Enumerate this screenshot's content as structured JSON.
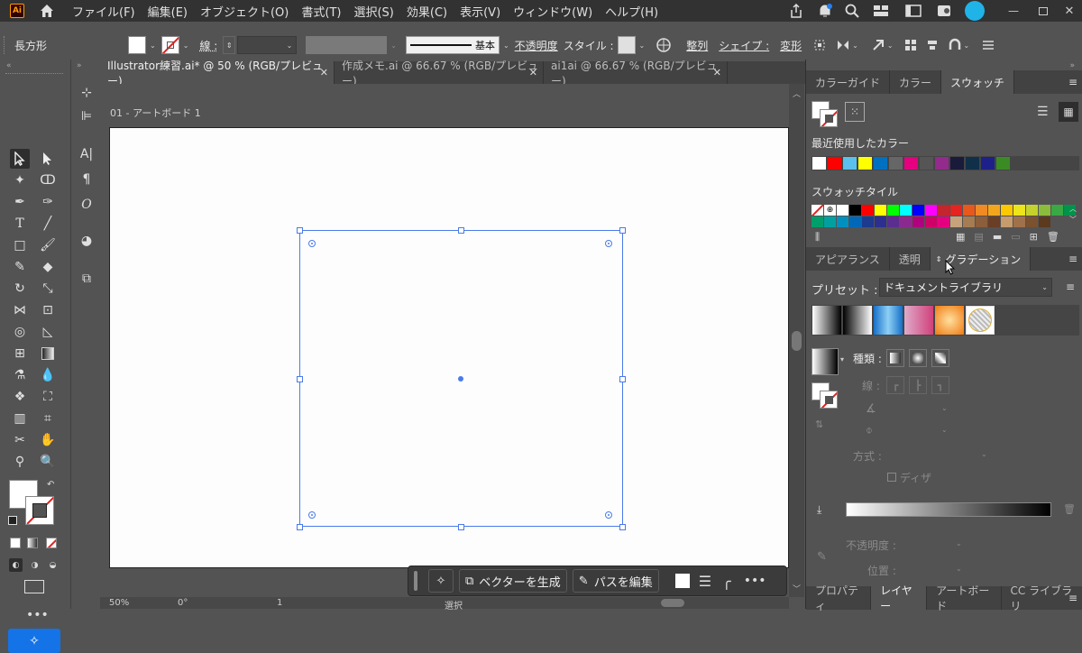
{
  "app": {
    "logo": "Ai"
  },
  "menu": [
    "ファイル(F)",
    "編集(E)",
    "オブジェクト(O)",
    "書式(T)",
    "選択(S)",
    "効果(C)",
    "表示(V)",
    "ウィンドウ(W)",
    "ヘルプ(H)"
  ],
  "control": {
    "object_type": "長方形",
    "stroke_label": "線 :",
    "stroke_style": "基本",
    "opacity_label": "不透明度",
    "style_label": "スタイル :",
    "align_label": "整列",
    "shape_label": "シェイプ :",
    "transform_label": "変形"
  },
  "tabs": [
    {
      "label": "Illustrator練習.ai* @ 50 % (RGB/プレビュー)",
      "active": true
    },
    {
      "label": "作成メモ.ai @ 66.67 % (RGB/プレビュー)",
      "active": false
    },
    {
      "label": "ai1ai @ 66.67 % (RGB/プレビュー)",
      "active": false
    }
  ],
  "canvas": {
    "artboard_label": "01 - アートボード 1"
  },
  "taskbar": {
    "generate_label": "ベクターを生成",
    "edit_path_label": "パスを編集"
  },
  "status": {
    "zoom": "50%",
    "angle": "0°",
    "artboard_num": "1",
    "tool": "選択"
  },
  "swatch_panel": {
    "tabs": [
      "カラーガイド",
      "カラー",
      "スウォッチ"
    ],
    "recent_label": "最近使用したカラー",
    "recent_colors": [
      "#ffffff",
      "#ff0000",
      "#5bc0eb",
      "#ffff00",
      "#0070c0",
      "#666666",
      "#e4007f",
      "#555555",
      "#922b8c",
      "#1a1a3a",
      "#10304a",
      "#1d2088",
      "#3b8b24"
    ],
    "tile_label": "スウォッチタイル",
    "tile_row1": [
      "#ffffff",
      "#000000",
      "#ff0000",
      "#ffff00",
      "#00ff00",
      "#00ffff",
      "#0000ff",
      "#ff00ff",
      "#c1272d",
      "#e52320",
      "#e8581c",
      "#f08a24",
      "#f3a61c",
      "#fcc800",
      "#ede51c",
      "#c4d22d",
      "#8bbd3d",
      "#39a845",
      "#00934a"
    ],
    "tile_row2": [
      "#009e6b",
      "#00a0a0",
      "#0090c0",
      "#0068b7",
      "#1d3a8e",
      "#2c2f8e",
      "#5a2d8e",
      "#8a2a8e",
      "#b0007f",
      "#d10068",
      "#e4007f",
      "#c8a27c",
      "#a67c52",
      "#8b5e3c",
      "#6b3e26",
      "#c69c6d",
      "#a0724b",
      "#7a5230",
      "#5b3a1e"
    ]
  },
  "gradient_panel": {
    "tabs": [
      "アピアランス",
      "透明",
      "グラデーション"
    ],
    "preset_label": "プリセット :",
    "preset_value": "ドキュメントライブラリ",
    "type_label": "種類 :",
    "stroke_label": "線 :",
    "method_label": "方式 :",
    "dither_label": "ディザ",
    "opacity_label": "不透明度 :",
    "position_label": "位置 :"
  },
  "bottom_tabs": [
    "プロパティ",
    "レイヤー",
    "アートボード",
    "CC ライブラリ"
  ]
}
